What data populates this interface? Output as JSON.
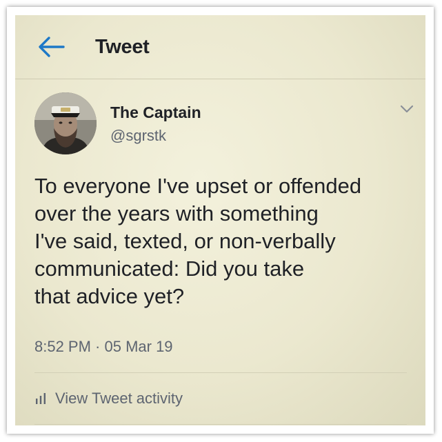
{
  "header": {
    "back_icon": "arrow-left-icon",
    "title": "Tweet"
  },
  "tweet": {
    "author_name": "The Captain",
    "author_handle": "@sgrstk",
    "avatar_icon": "profile-photo",
    "menu_icon": "chevron-down-icon",
    "text": "To everyone I've upset or offended\nover the years with something\nI've said, texted, or non-verbally\ncommunicated: Did you take\nthat advice yet?",
    "timestamp": "8:52 PM · 05 Mar 19"
  },
  "footer": {
    "activity_icon": "bar-chart-icon",
    "activity_label": "View Tweet activity"
  },
  "colors": {
    "accent": "#1d78c7",
    "text_primary": "#1f2126",
    "text_secondary": "#5d6470",
    "background": "#ebe8cf"
  }
}
